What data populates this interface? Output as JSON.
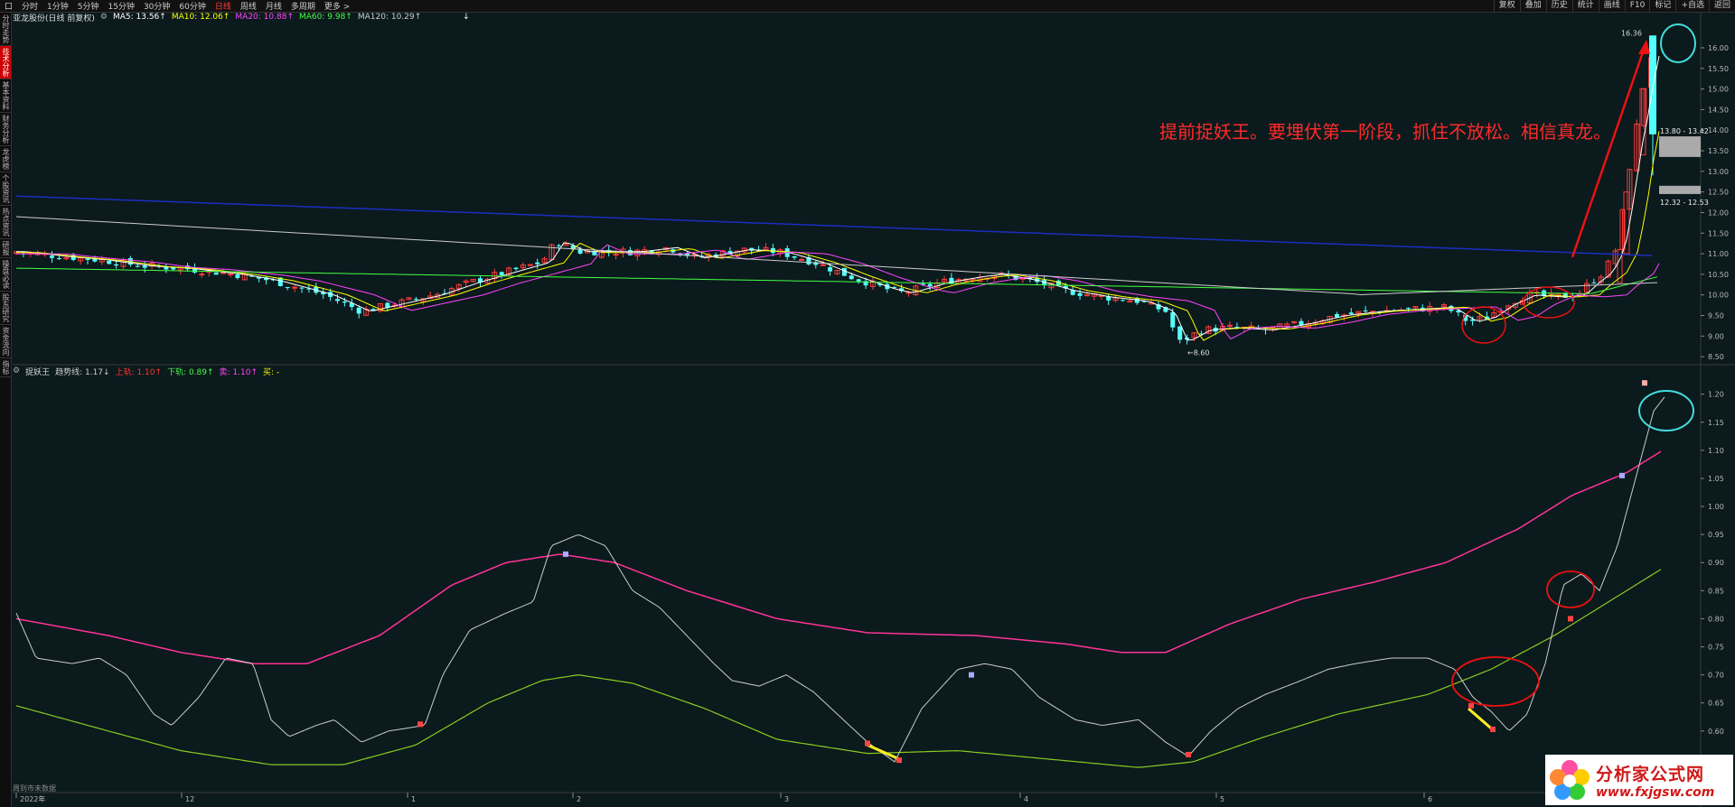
{
  "toolbar": {
    "tabs": [
      {
        "label": "口"
      },
      {
        "label": "分时"
      },
      {
        "label": "1分钟"
      },
      {
        "label": "5分钟"
      },
      {
        "label": "15分钟"
      },
      {
        "label": "30分钟"
      },
      {
        "label": "60分钟"
      },
      {
        "label": "日线",
        "active": true
      },
      {
        "label": "周线"
      },
      {
        "label": "月线"
      },
      {
        "label": "多周期"
      },
      {
        "label": "更多 >"
      }
    ],
    "right_buttons": [
      "复权",
      "叠加",
      "历史",
      "统计",
      "画线",
      "F10",
      "标记",
      "+自选",
      "返回"
    ]
  },
  "sidebar": {
    "items": [
      {
        "label": "分时走势"
      },
      {
        "label": "技术分析",
        "active": true
      },
      {
        "label": "基本资料"
      },
      {
        "label": "财务分析"
      },
      {
        "label": "龙虎榜"
      },
      {
        "label": "个股资讯"
      },
      {
        "label": "热点资讯"
      },
      {
        "label": "研报"
      },
      {
        "label": "操盘必读"
      },
      {
        "label": "股东研究"
      },
      {
        "label": "资金流向"
      },
      {
        "label": "指标"
      }
    ]
  },
  "legend_main": {
    "title": "亚龙股份(日线 前复权)",
    "ma5": "MA5: 13.56↑",
    "ma10": "MA10: 12.06↑",
    "ma20": "MA20: 10.88↑",
    "ma60": "MA60: 9.98↑",
    "ma120": "MA120: 10.29↑",
    "extra": "↓"
  },
  "legend_sub": {
    "title": "捉妖王",
    "item0": "趋势线: 1.17↓",
    "item1": "上轨: 1.10↑",
    "item2": "下轨: 0.89↑",
    "item3": "卖: 1.10↑",
    "item4": "买: -"
  },
  "annotation": "提前捉妖王。要埋伏第一阶段，抓住不放松。相信真龙。",
  "price_labels": {
    "high": "16.36",
    "low": "8.60",
    "box_top": "13.80 - 13.42",
    "box_bottom": "12.32 - 12.53"
  },
  "price_axis": [
    "16.00",
    "15.50",
    "15.00",
    "14.50",
    "14.00",
    "13.50",
    "13.00",
    "12.50",
    "12.00",
    "11.50",
    "11.00",
    "10.50",
    "10.00",
    "9.50",
    "9.00",
    "8.50"
  ],
  "indicator_axis": [
    "1.20",
    "1.15",
    "1.10",
    "1.05",
    "1.00",
    "0.95",
    "0.90",
    "0.85",
    "0.80",
    "0.75",
    "0.70",
    "0.65",
    "0.60",
    "0.55"
  ],
  "date_axis": [
    {
      "label": "2022年"
    },
    {
      "label": "12"
    },
    {
      "label": "1"
    },
    {
      "label": "2"
    },
    {
      "label": "3"
    },
    {
      "label": "4"
    },
    {
      "label": "5"
    },
    {
      "label": "6"
    }
  ],
  "footer_note": "周到市未数据",
  "watermark": {
    "line1": "分析家公式网",
    "line2": "www.fxjgsw.com"
  },
  "colors": {
    "up": "#ff3b3b",
    "down": "#54ffff",
    "ma5": "#ffffff",
    "ma10": "#ffff00",
    "ma20": "#ff44ff",
    "ma60": "#44ff44",
    "ma120": "#cccccc",
    "upper_band": "#ff3399",
    "lower_band": "#88cc22",
    "trend": "#cccccc",
    "annotation": "#ff2a2a",
    "circle_red": "#ee1111",
    "circle_cyan": "#44dddd"
  }
}
